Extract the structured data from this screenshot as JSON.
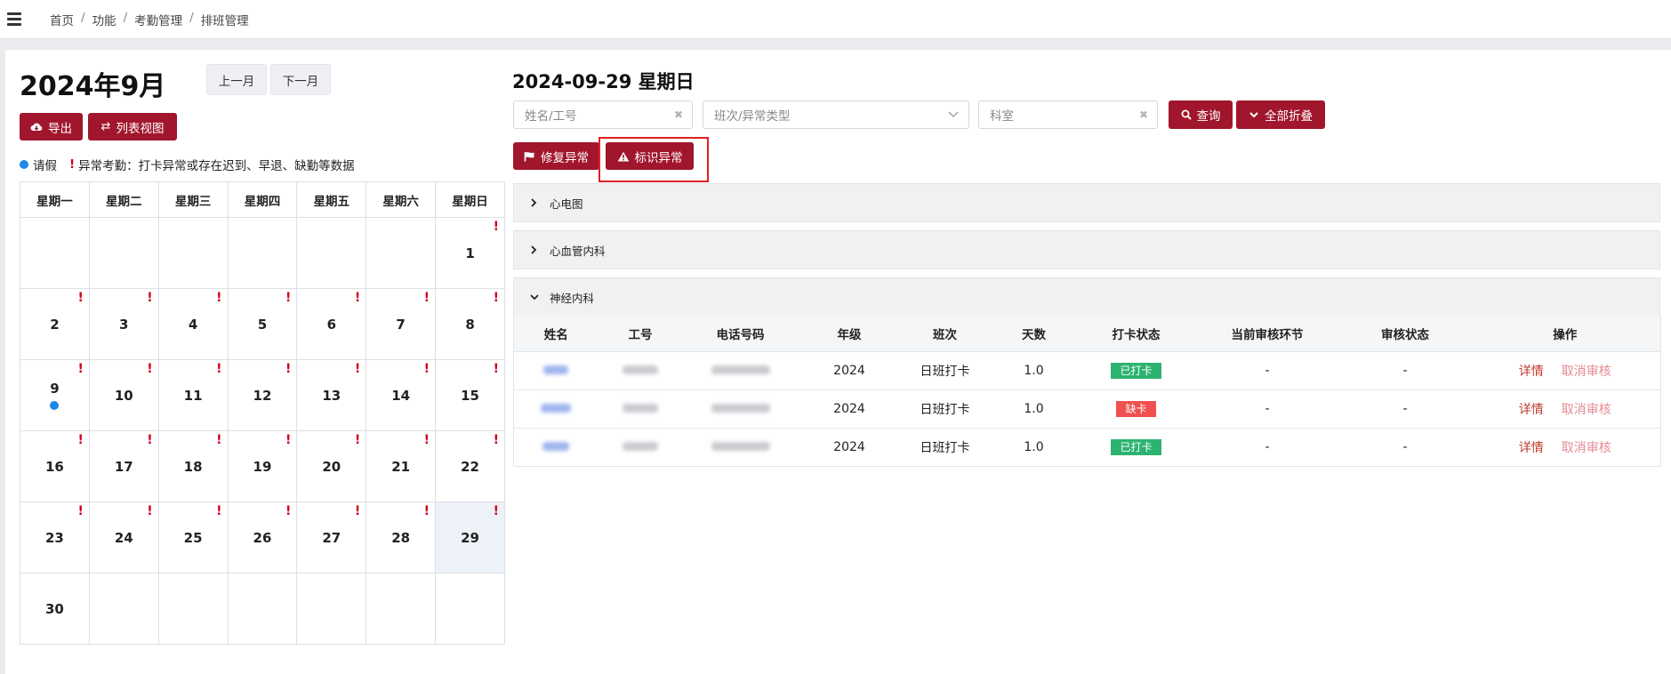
{
  "breadcrumb": [
    "首页",
    "功能",
    "考勤管理",
    "排班管理"
  ],
  "calendar": {
    "title": "2024年9月",
    "prev_label": "上一月",
    "next_label": "下一月",
    "export_label": "导出",
    "list_view_label": "列表视图",
    "legend_leave": "请假",
    "legend_abnormal": "异常考勤：打卡异常或存在迟到、早退、缺勤等数据",
    "weekdays": [
      "星期一",
      "星期二",
      "星期三",
      "星期四",
      "星期五",
      "星期六",
      "星期日"
    ],
    "abnormal_mark": "!",
    "weeks": [
      [
        "",
        "",
        "",
        "",
        "",
        "",
        "1"
      ],
      [
        "2",
        "3",
        "4",
        "5",
        "6",
        "7",
        "8"
      ],
      [
        "9",
        "10",
        "11",
        "12",
        "13",
        "14",
        "15"
      ],
      [
        "16",
        "17",
        "18",
        "19",
        "20",
        "21",
        "22"
      ],
      [
        "23",
        "24",
        "25",
        "26",
        "27",
        "28",
        "29"
      ],
      [
        "30",
        "",
        "",
        "",
        "",
        "",
        ""
      ]
    ],
    "abnormal_days": [
      "1",
      "2",
      "3",
      "4",
      "5",
      "6",
      "7",
      "8",
      "9",
      "10",
      "11",
      "12",
      "13",
      "14",
      "15",
      "16",
      "17",
      "18",
      "19",
      "20",
      "21",
      "22",
      "23",
      "24",
      "25",
      "26",
      "27",
      "28",
      "29"
    ],
    "leave_days": [
      "9"
    ],
    "selected_day": "29"
  },
  "detail": {
    "date_title": "2024-09-29 星期日",
    "search_placeholder": "姓名/工号",
    "type_placeholder": "班次/异常类型",
    "dept_placeholder": "科室",
    "query_label": "查询",
    "collapse_label": "全部折叠",
    "fix_label": "修复异常",
    "mark_label": "标识异常",
    "sections": [
      "心电图",
      "心血管内科",
      "神经内科"
    ],
    "columns": [
      "姓名",
      "工号",
      "电话号码",
      "年级",
      "班次",
      "天数",
      "打卡状态",
      "当前审核环节",
      "审核状态",
      "操作"
    ],
    "rows": [
      {
        "grade": "2024",
        "shift": "日班打卡",
        "days": "1.0",
        "status": "已打卡",
        "status_color": "#2db36f",
        "stage": "-",
        "review": "-",
        "detail": "详情",
        "cancel": "取消审核"
      },
      {
        "grade": "2024",
        "shift": "日班打卡",
        "days": "1.0",
        "status": "缺卡",
        "status_color": "#f0504f",
        "stage": "-",
        "review": "-",
        "detail": "详情",
        "cancel": "取消审核"
      },
      {
        "grade": "2024",
        "shift": "日班打卡",
        "days": "1.0",
        "status": "已打卡",
        "status_color": "#2db36f",
        "stage": "-",
        "review": "-",
        "detail": "详情",
        "cancel": "取消审核"
      }
    ]
  },
  "colors": {
    "accent": "#a1162c",
    "leave": "#1e88e5",
    "abnormal": "#d0021b"
  }
}
